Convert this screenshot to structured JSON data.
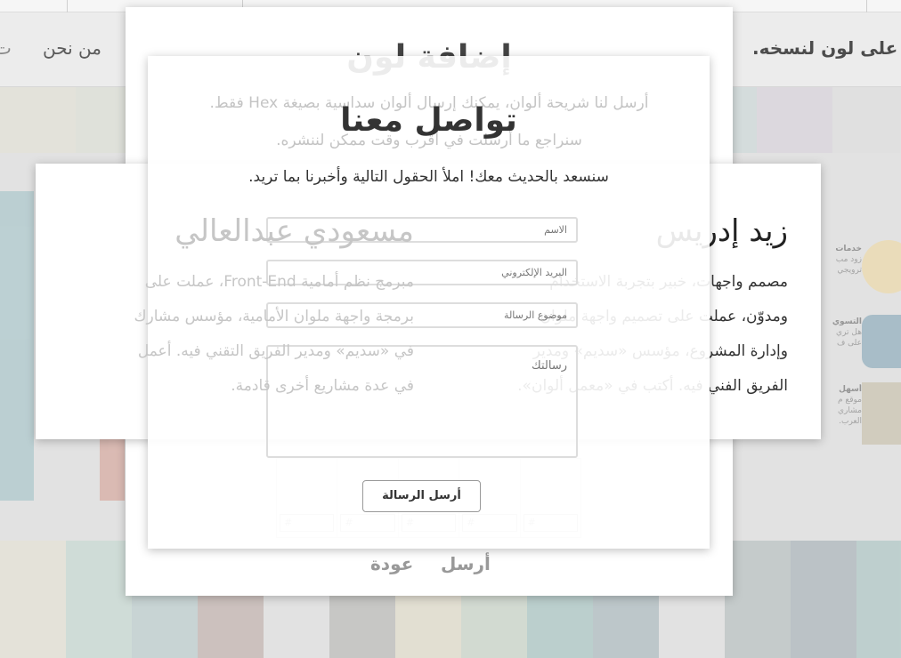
{
  "nav": {
    "about": "من نحن",
    "edge_char": "ت",
    "tagline": "على لون لنسخه."
  },
  "stripes": {
    "top": [
      "#e4e3d9",
      "#dfe1d9",
      "#dde0dc",
      "#d9dcd9",
      "#e0e0e0",
      "#dcdcdc",
      "#dbdcdd",
      "#d8dcdc",
      "#d6dfdf",
      "#d2dcdc",
      "#dcd7de",
      "#e0e0e0"
    ],
    "bottom": [
      "#e5e3d8",
      "#ccdbd6",
      "#c4d2d2",
      "#c9bcb8",
      "#e2e2e2",
      "#c3c3c0",
      "#e2dfd0",
      "#d0d9cf",
      "#b5ccca",
      "#b7c3c6",
      "#e2e2e2",
      "#c0c7c7",
      "#b5bdc2",
      "#b8cccb"
    ],
    "left_blue": "#b5ccd0",
    "left_pink": "#d9b4ab"
  },
  "sidebar": {
    "items": [
      {
        "title": "خدمات",
        "lines": [
          "زود مب",
          "ترويجي"
        ],
        "icon": "video-camera-icon",
        "color": "#ecdcb4"
      },
      {
        "title": "التسوي",
        "lines": [
          "هل تري",
          "على ف"
        ],
        "icon": "facebook-icon",
        "color": "#9fb7c4"
      },
      {
        "title": "أسهل",
        "lines": [
          "موقع م",
          "مشاري",
          "العرب."
        ],
        "icon": "thumbnail-image",
        "color": "#cfc9b8"
      }
    ]
  },
  "add_color": {
    "title": "إضافة لون",
    "line1": "أرسل لنا شريحة ألوان، يمكنك إرسال ألوان سداسية بصيغة Hex فقط.",
    "line2": "سنراجع ما أرسلت في أقرب وقت ممكن لننشره.",
    "hex_placeholder": "#",
    "submit": "أرسل",
    "back": "عودة"
  },
  "team": {
    "members": [
      {
        "name": "زيد إدريس",
        "bio": [
          "مصمم واجهات، خبير بتجربة الاستخدام",
          "ومدوّن، عملت على تصميم واجهة ملوان",
          "وإدارة المشروع، مؤسس «سديم» ومدير",
          "الفريق الفني فيه. أكتب في «معمل ألوان»."
        ]
      },
      {
        "name": "مسعودي عبدالعالي",
        "bio": [
          "مبرمج نظم أمامية Front-End، عملت على",
          "برمجة واجهة ملوان الأمامية، مؤسس مشارك",
          "في «سديم» ومدير الفريق التقني فيه. أعمل",
          "في عدة مشاريع أخرى قادمة."
        ]
      }
    ]
  },
  "contact": {
    "title": "تواصل معنا",
    "subtitle": "سنسعد بالحديث معك! املأ الحقول التالية وأخبرنا بما تريد.",
    "name_placeholder": "الاسم",
    "email_placeholder": "البريد الإلكتروني",
    "subject_placeholder": "موضوع الرسالة",
    "message_placeholder": "رسالتك",
    "send_label": "أرسل الرسالة"
  }
}
